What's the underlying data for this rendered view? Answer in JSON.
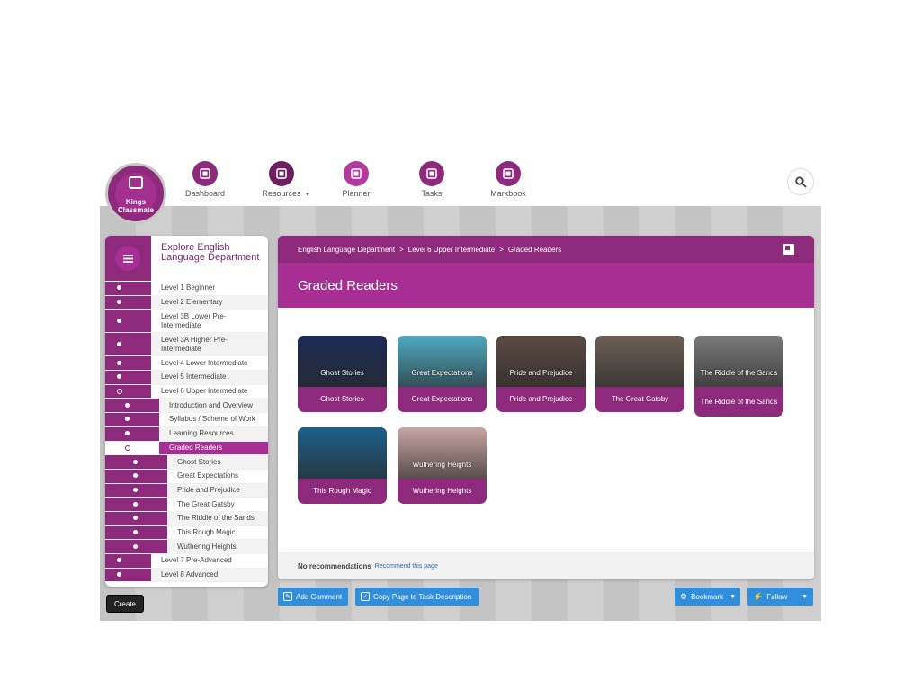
{
  "logo": {
    "text": "Kings Classmate"
  },
  "nav": [
    {
      "label": "Dashboard",
      "icon": "dashboard-icon",
      "color": "#8e2a7c"
    },
    {
      "label": "Resources",
      "icon": "resources-icon",
      "color": "#6d1f5f",
      "has_caret": true
    },
    {
      "label": "Planner",
      "icon": "planner-icon",
      "color": "#b23a9f"
    },
    {
      "label": "Tasks",
      "icon": "tasks-icon",
      "color": "#8e2a7c"
    },
    {
      "label": "Markbook",
      "icon": "markbook-icon",
      "color": "#8e2a7c"
    }
  ],
  "sidebar": {
    "title": "Explore English Language Department",
    "items": [
      {
        "label": "Level 1 Beginner",
        "depth": 0
      },
      {
        "label": "Level 2 Elementary",
        "depth": 0
      },
      {
        "label": "Level 3B Lower Pre-Intermediate",
        "depth": 0,
        "tall": true
      },
      {
        "label": "Level 3A Higher Pre-Intermediate",
        "depth": 0,
        "tall": true
      },
      {
        "label": "Level 4 Lower Intermediate",
        "depth": 0
      },
      {
        "label": "Level 5 Intermediate",
        "depth": 0
      },
      {
        "label": "Level 6 Upper Intermediate",
        "depth": 0,
        "open": true
      },
      {
        "label": "Introduction and Overview",
        "depth": 1
      },
      {
        "label": "Syllabus / Scheme of Work",
        "depth": 1
      },
      {
        "label": "Learning Resources",
        "depth": 1
      },
      {
        "label": "Graded Readers",
        "depth": 1,
        "active": true
      },
      {
        "label": "Ghost Stories",
        "depth": 2
      },
      {
        "label": "Great Expectations",
        "depth": 2
      },
      {
        "label": "Pride and Prejudice",
        "depth": 2
      },
      {
        "label": "The Great Gatsby",
        "depth": 2
      },
      {
        "label": "The Riddle of the Sands",
        "depth": 2
      },
      {
        "label": "This Rough Magic",
        "depth": 2
      },
      {
        "label": "Wuthering Heights",
        "depth": 2
      },
      {
        "label": "Level 7 Pre-Advanced",
        "depth": 0
      },
      {
        "label": "Level 8 Advanced",
        "depth": 0
      }
    ]
  },
  "create_label": "Create",
  "breadcrumb": [
    "English Language Department",
    "Level 6 Upper Intermediate",
    "Graded Readers"
  ],
  "breadcrumb_sep": ">",
  "page_title": "Graded Readers",
  "books": [
    {
      "caption": "Ghost Stories",
      "cover_text": "Ghost Stories",
      "cover_color": "#1b2a55"
    },
    {
      "caption": "Great Expectations",
      "cover_text": "Great Expectations",
      "cover_color": "#4fa9c0"
    },
    {
      "caption": "Pride and Prejudice",
      "cover_text": "Pride and Prejudice",
      "cover_color": "#5a4a44"
    },
    {
      "caption": "The Great Gatsby",
      "cover_text": "",
      "cover_color": "#6b5f55"
    },
    {
      "caption": "The Riddle of the Sands",
      "cover_text": "The Riddle of the Sands",
      "cover_color": "#7a7a7a"
    },
    {
      "caption": "This Rough Magic",
      "cover_text": "",
      "cover_color": "#1d5f8a"
    },
    {
      "caption": "Wuthering Heights",
      "cover_text": "Wuthering Heights",
      "cover_color": "#c8a6a4"
    }
  ],
  "recommendations": {
    "label": "No recommendations",
    "link": "Recommend this page"
  },
  "actions": {
    "add_comment": "Add Comment",
    "copy_page": "Copy Page to Task Description",
    "bookmark": "Bookmark",
    "follow": "Follow"
  },
  "colors": {
    "primary": "#8e2a7c",
    "accent": "#a72f93",
    "button_blue": "#2f8fdc"
  }
}
